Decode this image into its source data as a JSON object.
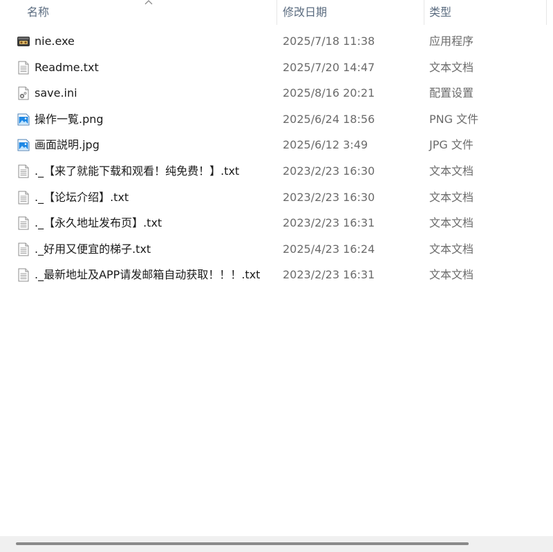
{
  "columns": {
    "name": "名称",
    "date": "修改日期",
    "type": "类型"
  },
  "files": [
    {
      "name": "nie.exe",
      "date": "2025/7/18 11:38",
      "type": "应用程序",
      "icon": "exe-app-icon"
    },
    {
      "name": "Readme.txt",
      "date": "2025/7/20 14:47",
      "type": "文本文档",
      "icon": "text-file-icon"
    },
    {
      "name": "save.ini",
      "date": "2025/8/16 20:21",
      "type": "配置设置",
      "icon": "config-file-icon"
    },
    {
      "name": "操作一覧.png",
      "date": "2025/6/24 18:56",
      "type": "PNG 文件",
      "icon": "image-file-icon"
    },
    {
      "name": "画面説明.jpg",
      "date": "2025/6/12 3:49",
      "type": "JPG 文件",
      "icon": "image-file-icon"
    },
    {
      "name": "._【来了就能下载和观看！纯免费！】.txt",
      "date": "2023/2/23 16:30",
      "type": "文本文档",
      "icon": "text-file-icon"
    },
    {
      "name": "._【论坛介绍】.txt",
      "date": "2023/2/23 16:30",
      "type": "文本文档",
      "icon": "text-file-icon"
    },
    {
      "name": "._【永久地址发布页】.txt",
      "date": "2023/2/23 16:31",
      "type": "文本文档",
      "icon": "text-file-icon"
    },
    {
      "name": "._好用又便宜的梯子.txt",
      "date": "2025/4/23 16:24",
      "type": "文本文档",
      "icon": "text-file-icon"
    },
    {
      "name": "._最新地址及APP请发邮箱自动获取！！！.txt",
      "date": "2023/2/23 16:31",
      "type": "文本文档",
      "icon": "text-file-icon"
    }
  ],
  "colors": {
    "header_text": "#5a6b7f",
    "secondary_text": "#6b6b6b",
    "image_icon_blue": "#1e88e5",
    "scrollbar_track": "#f0f0f0",
    "scrollbar_thumb": "#8a8a8a"
  }
}
